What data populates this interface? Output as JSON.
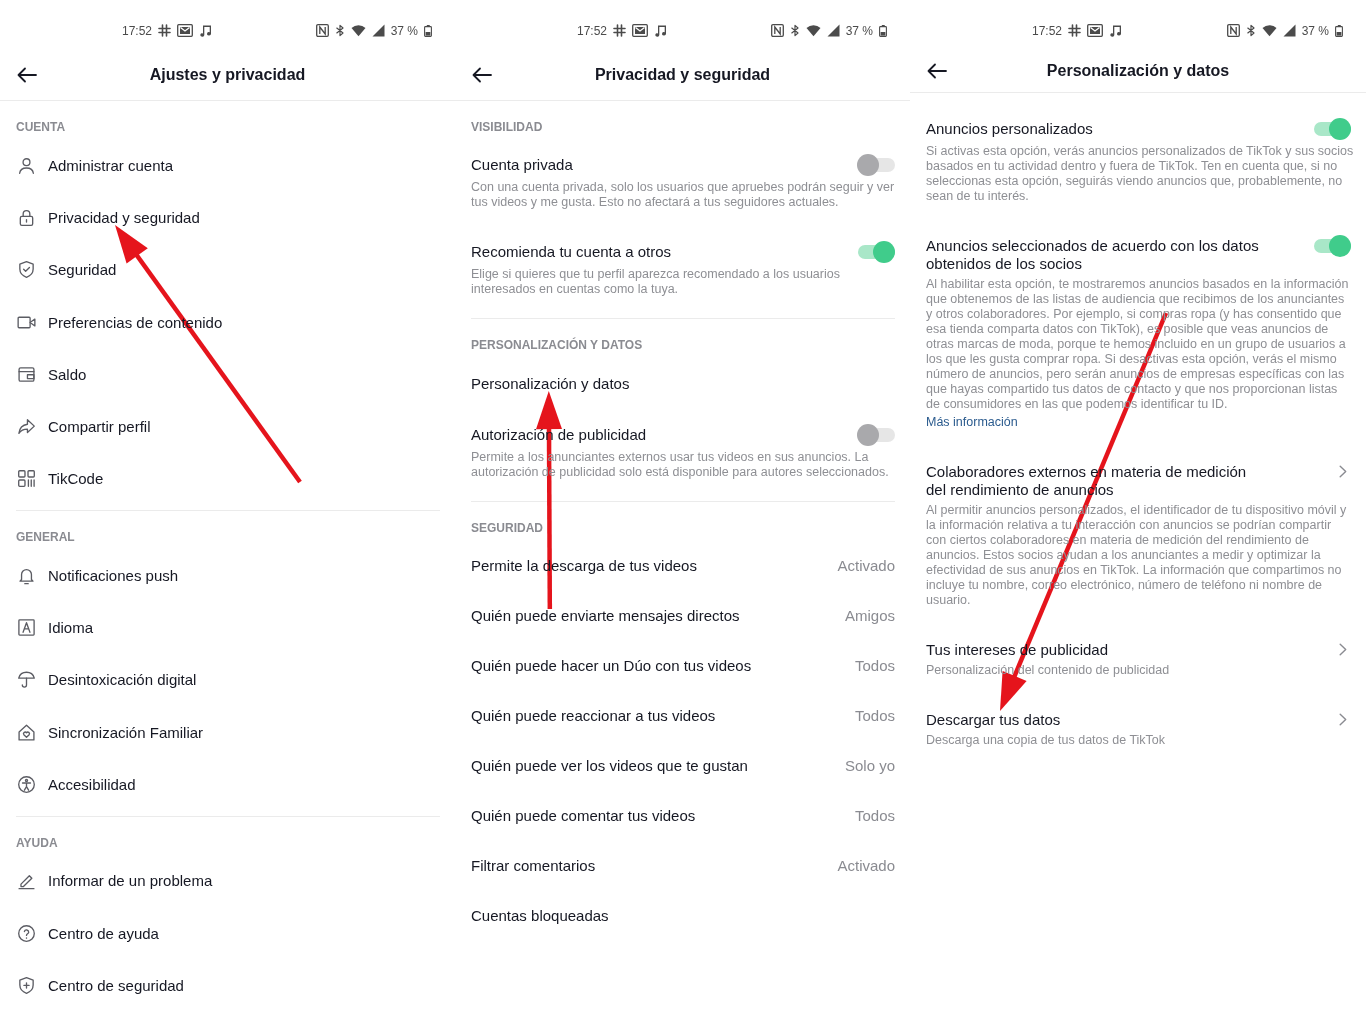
{
  "panels": [
    {
      "status_bar": {
        "time": "17:52",
        "battery": "37 %"
      },
      "header": {
        "title": "Ajustes y privacidad"
      },
      "sections": [
        {
          "title": "CUENTA",
          "items": [
            {
              "kind": "nav",
              "label": "Administrar cuenta",
              "arrow": false
            },
            {
              "kind": "nav",
              "label": "Privacidad y seguridad",
              "arrow": true
            },
            {
              "kind": "nav",
              "label": "Seguridad",
              "arrow": false
            },
            {
              "kind": "nav",
              "label": "Preferencias de contenido",
              "arrow": false
            },
            {
              "kind": "nav",
              "label": "Saldo",
              "arrow": false
            },
            {
              "kind": "nav",
              "label": "Compartir perfil",
              "arrow": false
            },
            {
              "kind": "nav",
              "label": "TikCode",
              "arrow": false
            }
          ]
        },
        {
          "title": "GENERAL",
          "items": [
            {
              "kind": "nav",
              "label": "Notificaciones push",
              "arrow": false
            },
            {
              "kind": "nav",
              "label": "Idioma",
              "arrow": false
            },
            {
              "kind": "nav",
              "label": "Desintoxicación digital",
              "arrow": false
            },
            {
              "kind": "nav",
              "label": "Sincronización Familiar",
              "arrow": false
            },
            {
              "kind": "nav",
              "label": "Accesibilidad",
              "arrow": false
            }
          ]
        },
        {
          "title": "AYUDA",
          "items": [
            {
              "kind": "nav",
              "label": "Informar de un problema",
              "arrow": false
            },
            {
              "kind": "nav",
              "label": "Centro de ayuda",
              "arrow": false
            },
            {
              "kind": "nav",
              "label": "Centro de seguridad",
              "arrow": false
            }
          ]
        }
      ]
    },
    {
      "status_bar": {
        "time": "17:52",
        "battery": "37 %"
      },
      "header": {
        "title": "Privacidad y seguridad"
      },
      "sections": [
        {
          "title": "VISIBILIDAD",
          "items": [
            {
              "kind": "toggle",
              "title": "Cuenta privada",
              "description": "Con una cuenta privada, solo los usuarios que apruebes podrán seguir y ver tus videos y me gusta. Esto no afectará a tus seguidores actuales.",
              "on": false,
              "arrow": false
            },
            {
              "kind": "toggle",
              "title": "Recomienda tu cuenta a otros",
              "description": "Elige si quieres que tu perfil aparezca recomendado a los usuarios interesados en cuentas como la tuya.",
              "on": true,
              "arrow": false
            }
          ]
        },
        {
          "title": "PERSONALIZACIÓN Y DATOS",
          "items": [
            {
              "kind": "link",
              "title": "Personalización y datos",
              "arrow": true
            },
            {
              "kind": "toggle",
              "title": "Autorización de publicidad",
              "description": "Permite a los anunciantes externos usar tus videos en sus anuncios. La autorización de publicidad solo está disponible para autores seleccionados.",
              "on": false,
              "arrow": false
            }
          ]
        },
        {
          "title": "SEGURIDAD",
          "items": [
            {
              "kind": "value",
              "title": "Permite la descarga de tus videos",
              "value": "Activado",
              "arrow": false
            },
            {
              "kind": "value",
              "title": "Quién puede enviarte mensajes directos",
              "value": "Amigos",
              "arrow": false
            },
            {
              "kind": "value",
              "title": "Quién puede hacer un Dúo con tus videos",
              "value": "Todos",
              "arrow": false
            },
            {
              "kind": "value",
              "title": "Quién puede reaccionar a tus videos",
              "value": "Todos",
              "arrow": false
            },
            {
              "kind": "value",
              "title": "Quién puede ver los videos que te gustan",
              "value": "Solo yo",
              "arrow": false
            },
            {
              "kind": "value",
              "title": "Quién puede comentar tus videos",
              "value": "Todos",
              "arrow": false
            },
            {
              "kind": "value",
              "title": "Filtrar comentarios",
              "value": "Activado",
              "arrow": false
            },
            {
              "kind": "value",
              "title": "Cuentas bloqueadas",
              "arrow": false
            }
          ]
        }
      ]
    },
    {
      "status_bar": {
        "time": "17:52",
        "battery": "37 %"
      },
      "header": {
        "title": "Personalización y datos"
      },
      "sections": [
        {
          "items": [
            {
              "kind": "toggle",
              "title": "Anuncios personalizados",
              "description": "Si activas esta opción, verás anuncios personalizados de TikTok y sus socios basados en tu actividad dentro y fuera de TikTok. Ten en cuenta que, si no seleccionas esta opción, seguirás viendo anuncios que, probablemente, no sean de tu interés.",
              "on": true,
              "arrow": false
            },
            {
              "kind": "toggle",
              "title": "Anuncios seleccionados de acuerdo con los datos obtenidos de los socios",
              "description": "Al habilitar esta opción, te mostraremos anuncios basados en la información que obtenemos de las listas de audiencia que recibimos de los anunciantes y otros colaboradores. Por ejemplo, si compras ropa (y has consentido que esa tienda comparta datos con TikTok), es posible que veas anuncios de otras marcas de moda, porque te hemos incluido en un grupo de usuarios a los que les gusta comprar ropa. Si desactivas esta opción, verás el mismo número de anuncios, pero serán anuncios de empresas específicas con las que hayas compartido tus datos de contacto y que nos proporcionan listas de consumidores en las que podemos identificar tu ID.",
              "link": "Más información",
              "on": true,
              "arrow": false
            },
            {
              "kind": "detail",
              "title": "Colaboradores externos en materia de medición del rendimiento de anuncios",
              "description": "Al permitir anuncios personalizados, el identificador de tu dispositivo móvil y la información relativa a tu interacción con anuncios se podrían compartir con ciertos colaboradores en materia de medición del rendimiento de anuncios. Estos socios ayudan a los anunciantes a medir y optimizar la efectividad de sus anuncios en TikTok. La información que compartimos no incluye tu nombre, correo electrónico, número de teléfono ni nombre de usuario.",
              "arrow": false
            },
            {
              "kind": "detail",
              "title": "Tus intereses de publicidad",
              "description": "Personalización del contenido de publicidad",
              "arrow": false
            },
            {
              "kind": "detail",
              "title": "Descargar tus datos",
              "description": "Descarga una copia de tus datos de TikTok",
              "arrow": true
            }
          ]
        }
      ]
    }
  ]
}
